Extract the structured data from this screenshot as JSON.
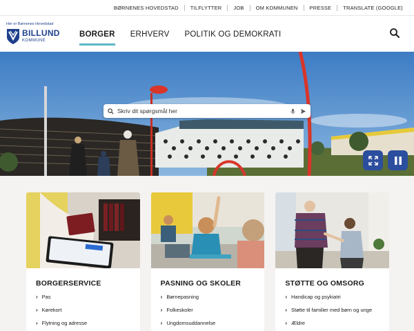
{
  "utility_links": [
    {
      "label": "BØRNENES HOVEDSTAD"
    },
    {
      "label": "TILFLYTTER"
    },
    {
      "label": "JOB"
    },
    {
      "label": "OM KOMMUNEN"
    },
    {
      "label": "PRESSE"
    },
    {
      "label": "TRANSLATE (GOOGLE)"
    }
  ],
  "logo": {
    "tagline": "Her er Børnenes Hovedstad",
    "name": "BILLUND",
    "sub": "KOMMUNE",
    "brand_color": "#1d3f8c"
  },
  "nav": {
    "items": [
      {
        "label": "BORGER",
        "active": true
      },
      {
        "label": "ERHVERV",
        "active": false
      },
      {
        "label": "POLITIK OG DEMOKRATI",
        "active": false
      }
    ],
    "accent_color": "#5bb8c6",
    "search_icon": "search-icon"
  },
  "hero": {
    "search_placeholder": "Skriv dit spørgsmål her",
    "mic_icon": "microphone-icon",
    "send_icon": "send-icon",
    "expand_icon": "expand-icon",
    "pause_icon": "pause-icon",
    "control_color": "#2c4e9e"
  },
  "cards": [
    {
      "title": "BORGERSERVICE",
      "image": "passport-tablet-photo",
      "links": [
        "Pas",
        "Kørekort",
        "Flytning og adresse"
      ]
    },
    {
      "title": "PASNING OG SKOLER",
      "image": "classroom-photo",
      "links": [
        "Børnepasning",
        "Folkeskoler",
        "Ungdomsuddannelse"
      ]
    },
    {
      "title": "STØTTE OG OMSORG",
      "image": "elderly-care-photo",
      "links": [
        "Handicap og psykiatri",
        "Støtte til familier med børn og unge",
        "Ældre"
      ]
    }
  ]
}
